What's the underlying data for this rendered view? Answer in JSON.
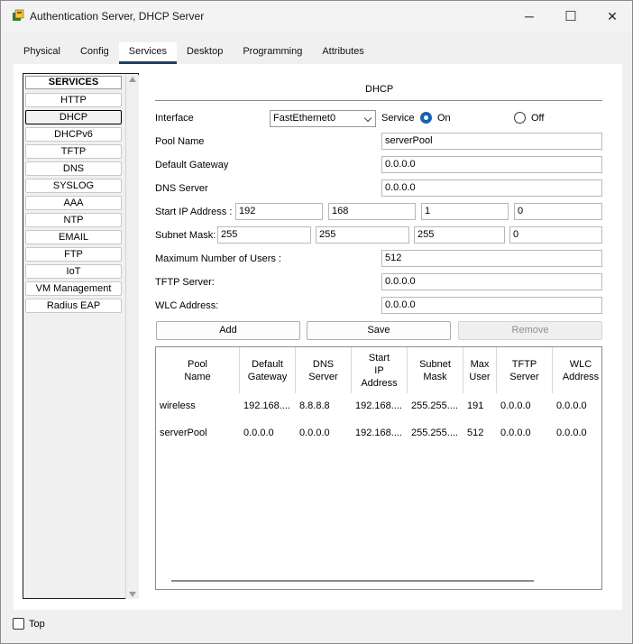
{
  "window": {
    "title": "Authentication Server, DHCP Server",
    "minimize": "─",
    "maximize": "☐",
    "close": "✕"
  },
  "tabs": [
    "Physical",
    "Config",
    "Services",
    "Desktop",
    "Programming",
    "Attributes"
  ],
  "active_tab": "Services",
  "services": {
    "header": "SERVICES",
    "items": [
      "HTTP",
      "DHCP",
      "DHCPv6",
      "TFTP",
      "DNS",
      "SYSLOG",
      "AAA",
      "NTP",
      "EMAIL",
      "FTP",
      "IoT",
      "VM Management",
      "Radius EAP"
    ],
    "selected": "DHCP"
  },
  "dhcp": {
    "title": "DHCP",
    "interface_label": "Interface",
    "interface_value": "FastEthernet0",
    "service_label": "Service",
    "on_label": "On",
    "off_label": "Off",
    "service_state": "On",
    "pool_name_label": "Pool Name",
    "pool_name": "serverPool",
    "default_gateway_label": "Default Gateway",
    "default_gateway": "0.0.0.0",
    "dns_server_label": "DNS Server",
    "dns_server": "0.0.0.0",
    "start_ip_label": "Start IP Address :",
    "start_ip": [
      "192",
      "168",
      "1",
      "0"
    ],
    "subnet_mask_label": "Subnet Mask:",
    "subnet_mask": [
      "255",
      "255",
      "255",
      "0"
    ],
    "max_users_label": "Maximum Number of Users :",
    "max_users": "512",
    "tftp_label": "TFTP Server:",
    "tftp": "0.0.0.0",
    "wlc_label": "WLC Address:",
    "wlc": "0.0.0.0",
    "buttons": {
      "add": "Add",
      "save": "Save",
      "remove": "Remove"
    }
  },
  "table": {
    "headers": [
      "Pool\nName",
      "Default\nGateway",
      "DNS\nServer",
      "Start\nIP\nAddress",
      "Subnet\nMask",
      "Max\nUser",
      "TFTP\nServer",
      "WLC\nAddress"
    ],
    "rows": [
      [
        "wireless",
        "192.168....",
        "8.8.8.8",
        "192.168....",
        "255.255....",
        "191",
        "0.0.0.0",
        "0.0.0.0"
      ],
      [
        "serverPool",
        "0.0.0.0",
        "0.0.0.0",
        "192.168....",
        "255.255....",
        "512",
        "0.0.0.0",
        "0.0.0.0"
      ]
    ]
  },
  "footer": {
    "top_label": "Top"
  }
}
